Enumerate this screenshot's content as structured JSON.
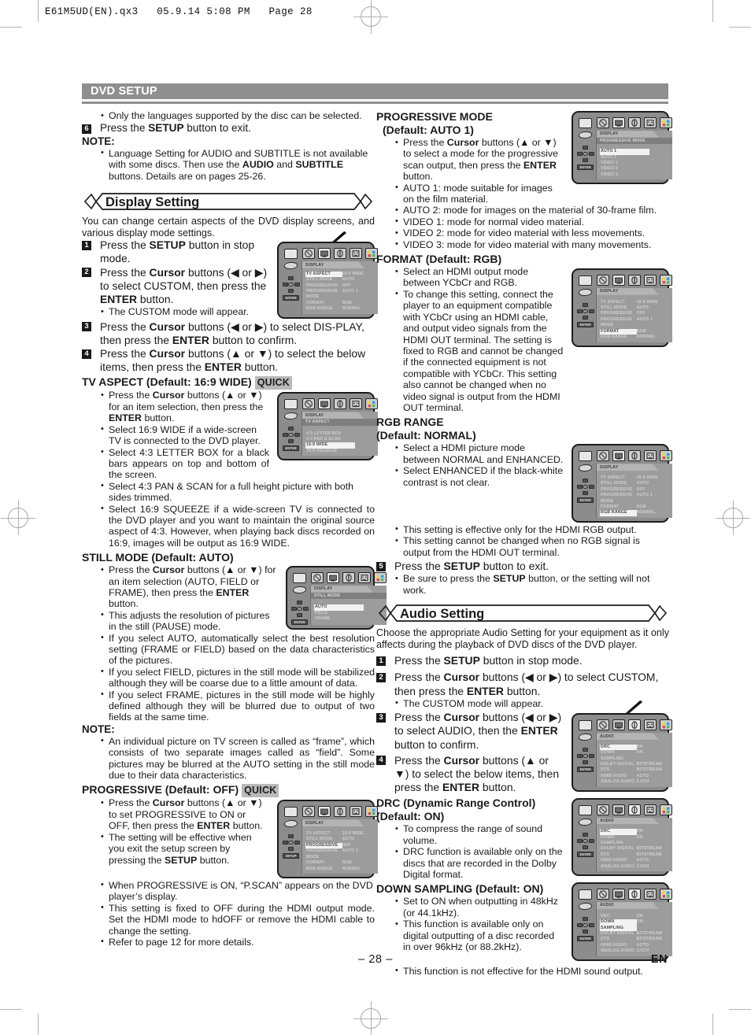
{
  "header": {
    "file_line": "E61M5UD(EN).qx3   05.9.14 5:08 PM   Page 28"
  },
  "banner": {
    "title": "DVD SETUP"
  },
  "footer": {
    "page_number": "– 28 –",
    "language_code": "EN"
  },
  "left_column": {
    "intro_bullet": "Only the languages supported by the disc can be selected.",
    "step6_pre": "Press the ",
    "step6_bold": "SETUP",
    "step6_post": " button to exit.",
    "step6_num": "6",
    "note_label": "NOTE:",
    "note_bullet_1a": "Language Setting for AUDIO and SUBTITLE is not available with some discs. Then use the ",
    "note_bullet_1b": "AUDIO",
    "note_bullet_1c": " and ",
    "note_bullet_1d": "SUBTITLE",
    "note_bullet_1e": " buttons. Details are on pages 25-26.",
    "display_setting_title": "Display Setting",
    "display_intro": "You can change certain aspects of the DVD display screens, and various display mode settings.",
    "steps": [
      {
        "num": "1",
        "pre": "Press the ",
        "bold": "SETUP",
        "post": " button in stop mode."
      },
      {
        "num": "2",
        "pre": "Press the ",
        "bold": "Cursor",
        "post": " buttons (◀ or ▶) to select CUSTOM, then press the ",
        "bold2": "ENTER",
        "post2": " button."
      },
      {
        "num": "3",
        "pre": "Press the ",
        "bold": "Cursor",
        "post": " buttons (◀ or ▶) to select DIS-PLAY, then press the ",
        "bold2": "ENTER",
        "post2": " button to confirm."
      },
      {
        "num": "4",
        "pre": "Press the ",
        "bold": "Cursor",
        "post": " buttons (▲ or ▼) to select the below items, then press the ",
        "bold2": "ENTER",
        "post2": " button."
      }
    ],
    "step2_note": "The CUSTOM mode will appear.",
    "tv_aspect": {
      "heading": "TV ASPECT (Default: 16:9 WIDE)",
      "quick": "QUICK",
      "b1_pre": "Press the ",
      "b1_bold": "Cursor",
      "b1_mid": " buttons (▲ or ▼) for an item selection, then press the ",
      "b1_bold2": "ENTER",
      "b1_post": " button.",
      "b2": "Select 16:9 WIDE if a wide-screen TV is connected to the DVD player.",
      "b3": "Select 4:3 LETTER BOX for a black bars appears on top and bottom of the screen.",
      "b4": "Select 4:3 PAN & SCAN for a full height picture with both sides trimmed.",
      "b5": "Select 16:9 SQUEEZE if a wide-screen TV is connected to the DVD player and you want to maintain the original source aspect of 4:3. However, when playing back discs recorded on 16:9, images will be output as 16:9 WIDE."
    },
    "still_mode": {
      "heading": "STILL MODE (Default: AUTO)",
      "b1_pre": "Press the ",
      "b1_bold": "Cursor",
      "b1_mid": " buttons (▲ or ▼) for an item selection (AUTO, FIELD or FRAME), then press the ",
      "b1_bold2": "ENTER",
      "b1_post": " button.",
      "b2": "This adjusts the resolution of pictures in the still (PAUSE) mode.",
      "b3": "If you select AUTO, automatically select the best resolution setting (FRAME or FIELD) based on the data characteristics of the pictures.",
      "b4": "If you select FIELD, pictures in the still mode will be stabilized although they will be coarse due to a little amount of data.",
      "b5": "If you select FRAME, pictures in the still mode will be highly defined although they will be blurred due to output of two fields at the same time.",
      "note_label": "NOTE:",
      "note": "An individual picture on TV screen is called as “frame”, which consists of two separate images called as “field”. Some pictures may be blurred at the AUTO setting in the still mode due to their data characteristics."
    },
    "progressive": {
      "heading": "PROGRESSIVE (Default: OFF)",
      "quick": "QUICK",
      "b1_pre": "Press the ",
      "b1_bold": "Cursor",
      "b1_mid": " buttons (▲ or ▼) to set PROGRESSIVE to ON or OFF, then press the ",
      "b1_bold2": "ENTER",
      "b1_post": " button.",
      "b2_pre": "The setting will be effective when you exit the setup screen by pressing the ",
      "b2_bold": "SETUP",
      "b2_post": " button.",
      "b3": "When PROGRESSIVE is ON, “P.SCAN” appears on the DVD player’s display.",
      "b4": "This setting is fixed to OFF during the HDMI output mode. Set the HDMI mode to hdOFF or remove the HDMI cable to change the setting.",
      "b5": "Refer to page 12 for more details."
    }
  },
  "right_column": {
    "progressive_mode": {
      "heading_l1": "PROGRESSIVE MODE",
      "heading_l2": "(Default: AUTO 1)",
      "b1_pre": "Press the ",
      "b1_bold": "Cursor",
      "b1_mid": " buttons (▲ or ▼) to select a mode for the progressive scan output, then press the ",
      "b1_bold2": "ENTER",
      "b1_post": " button.",
      "b2": "AUTO 1: mode suitable for images on the film material.",
      "b3": "AUTO 2: mode for images on the material of 30-frame film.",
      "b4": "VIDEO 1: mode for normal video material.",
      "b5": "VIDEO 2: mode for video material with less movements.",
      "b6": "VIDEO 3: mode for video material with many movements."
    },
    "format": {
      "heading": "FORMAT (Default: RGB)",
      "b1": "Select an HDMI output mode between YCbCr and RGB.",
      "b2": "To change this setting, connect the player to an equipment compatible with YCbCr using an HDMI cable, and output video signals from the HDMI OUT terminal. The setting is fixed to RGB and cannot be changed if the connected equipment is not compatible with YCbCr. This setting also cannot be changed when no video signal is output from the HDMI OUT terminal."
    },
    "rgb_range": {
      "heading_l1": "RGB RANGE",
      "heading_l2": "(Default: NORMAL)",
      "b1": "Select a HDMI picture mode between NORMAL and ENHANCED.",
      "b2": "Select ENHANCED if the black-white contrast is not clear.",
      "b3": "This setting is effective only for the HDMI RGB output.",
      "b4": "This setting cannot be changed when no RGB signal is output from the HDMI OUT terminal."
    },
    "step5": {
      "num": "5",
      "pre": "Press the ",
      "bold": "SETUP",
      "post": " button to exit."
    },
    "step5_note_pre": "Be sure to press the ",
    "step5_note_bold": "SETUP",
    "step5_note_post": " button, or the setting will not work.",
    "audio_setting": {
      "title": "Audio Setting",
      "intro": "Choose the appropriate Audio Setting for your equipment as it only affects during the playback of DVD discs of the DVD player.",
      "steps": [
        {
          "num": "1",
          "pre": "Press the ",
          "bold": "SETUP",
          "post": " button in stop mode."
        },
        {
          "num": "2",
          "pre": "Press the ",
          "bold": "Cursor",
          "post": " buttons (◀ or ▶) to select CUSTOM, then press the ",
          "bold2": "ENTER",
          "post2": " button."
        },
        {
          "num": "3",
          "pre": "Press the ",
          "bold": "Cursor",
          "post": " buttons (◀ or ▶) to select AUDIO, then the ",
          "bold2": "ENTER",
          "post2": " button to confirm."
        },
        {
          "num": "4",
          "pre": "Press the ",
          "bold": "Cursor",
          "post": " buttons (▲ or ▼) to select the below items, then press the ",
          "bold2": "ENTER",
          "post2": " button."
        }
      ],
      "step2_note": "The CUSTOM mode will appear.",
      "drc": {
        "heading_l1": "DRC (Dynamic Range Control)",
        "heading_l2": "(Default: ON)",
        "b1": "To compress the range of sound volume.",
        "b2": "DRC function is available only on the discs that are recorded in the Dolby Digital format."
      },
      "down_sampling": {
        "heading": "DOWN SAMPLING (Default: ON)",
        "b1": "Set to ON when outputting in 48kHz (or 44.1kHz).",
        "b2": "This function is available only on digital outputting of a disc recorded in over 96kHz (or 88.2kHz).",
        "b3": "This function is not effective for the HDMI sound output."
      }
    }
  },
  "osd_screens": {
    "display_full": {
      "tab": "DISPLAY",
      "rows": [
        {
          "k": "TV ASPECT",
          "v": "16:9 WIDE"
        },
        {
          "k": "STILL MODE",
          "v": "AUTO"
        },
        {
          "k": "PROGRESSIVE",
          "v": "OFF"
        },
        {
          "k": "PROGRESSIVE MODE",
          "v": "AUTO 1"
        },
        {
          "k": "FORMAT",
          "v": "RGB"
        },
        {
          "k": "RGB RANGE",
          "v": "NORMAL"
        }
      ]
    },
    "tv_aspect": {
      "tab": "DISPLAY",
      "sub": "TV ASPECT",
      "items": [
        "4:3 LETTER BOX",
        "4:3 PAN & SCAN",
        "16:9 WIDE",
        "16:9 SQUEEZE"
      ],
      "selected": "16:9 WIDE"
    },
    "still_mode": {
      "tab": "DISPLAY",
      "sub": "STILL MODE",
      "items": [
        "AUTO",
        "FIELD",
        "FRAME"
      ],
      "selected": "AUTO"
    },
    "progressive": {
      "tab": "DISPLAY",
      "selected_row": "PROGRESSIVE"
    },
    "progressive_mode": {
      "tab": "DISPLAY",
      "sub": "PROGRESSIVE MODE",
      "items": [
        "AUTO 1",
        "AUTO 2",
        "VIDEO 1",
        "VIDEO 2",
        "VIDEO 3"
      ],
      "selected": "AUTO 1"
    },
    "format": {
      "tab": "DISPLAY",
      "selected_row": "FORMAT"
    },
    "rgb_range": {
      "tab": "DISPLAY",
      "selected_row": "RGB RANGE"
    },
    "audio": {
      "tab": "AUDIO",
      "rows": [
        {
          "k": "DRC",
          "v": "ON"
        },
        {
          "k": "DOWN SAMPLING",
          "v": "ON"
        },
        {
          "k": "DOLBY DIGITAL",
          "v": "BITSTREAM"
        },
        {
          "k": "DTS",
          "v": "BITSTREAM"
        },
        {
          "k": "HDMI AUDIO",
          "v": "AUTO"
        },
        {
          "k": "ANALOG AUDIO",
          "v": "2.0CH"
        }
      ],
      "selected_drc": "DRC",
      "selected_down_sampling": "DOWN SAMPLING"
    },
    "enter_label": "ENTER",
    "setup_label": "SETUP"
  }
}
